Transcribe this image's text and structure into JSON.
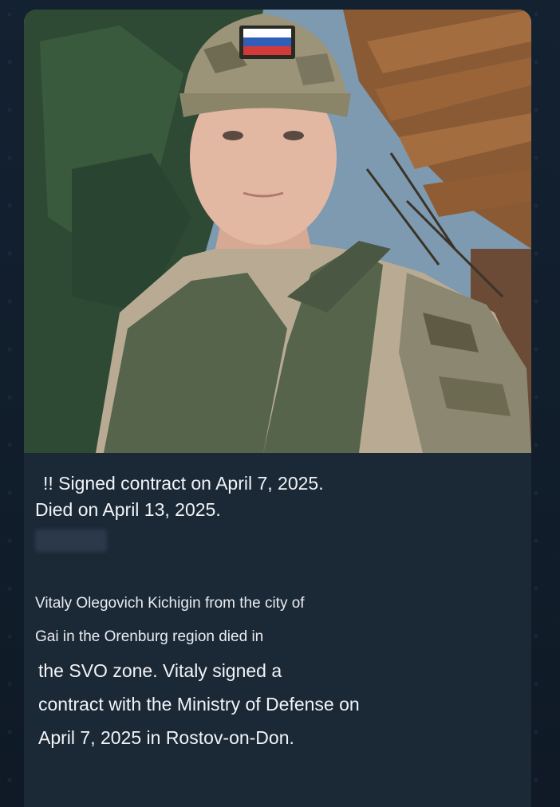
{
  "message": {
    "headline": {
      "line1": "!! Signed contract on April 7, 2025.",
      "line2": "Died on April 13, 2025."
    },
    "body_small": [
      "Vitaly Olegovich Kichigin from the city of",
      "Gai in the Orenburg region died in"
    ],
    "body_large": [
      "the SVO zone. Vitaly signed a",
      "contract with the Ministry of Defense on",
      "April 7, 2025 in Rostov-on-Don."
    ]
  },
  "colors": {
    "background": "#0f1a26",
    "bubble": "#1b2836",
    "text": "#f2f4f7"
  }
}
